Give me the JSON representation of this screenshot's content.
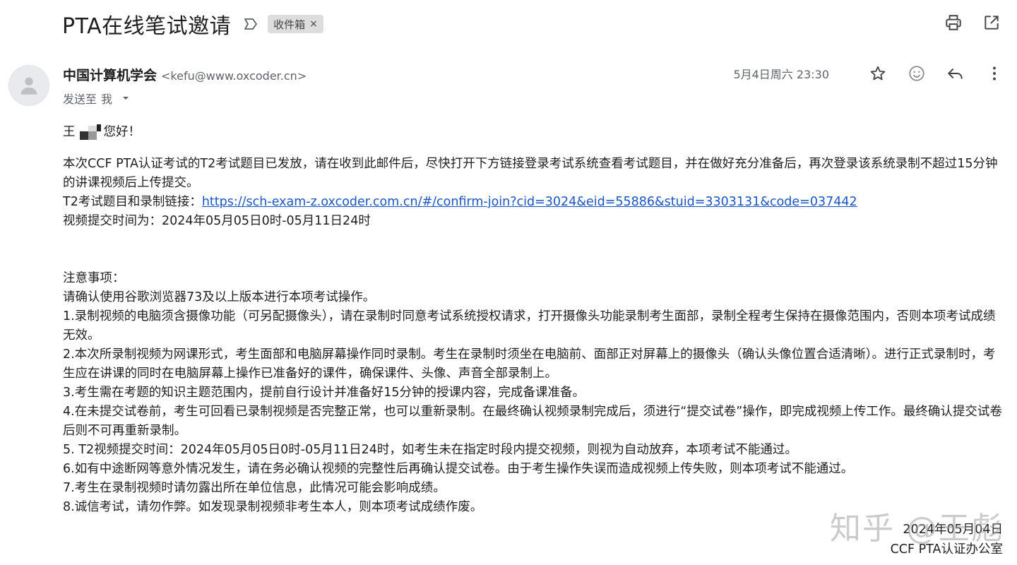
{
  "email": {
    "subject": "PTA在线笔试邀请",
    "label_chip": "收件箱",
    "label_close": "×",
    "sender_name": "中国计算机学会",
    "sender_email": "<kefu@www.oxcoder.cn>",
    "to_prefix": "发送至",
    "to_recipient": "我",
    "date": "5月4日周六 23:30"
  },
  "icons": {
    "important": "label-important-icon",
    "print": "print-icon",
    "open_new_window": "open-in-new-icon",
    "star": "star-icon",
    "emoji": "emoji-icon",
    "reply": "reply-icon",
    "more": "more-vert-icon",
    "expand": "caret-down-icon",
    "avatar": "person-icon"
  },
  "body": {
    "greeting_prefix": "王",
    "greeting_suffix": "您好！",
    "para1": "本次CCF PTA认证考试的T2考试题目已发放，请在收到此邮件后，尽快打开下方链接登录考试系统查看考试题目，并在做好充分准备后，再次登录该系统录制不超过15分钟的讲课视频后上传提交。",
    "link_label": "T2考试题目和录制链接：",
    "link_url": "https://sch-exam-z.oxcoder.com.cn/#/confirm-join?cid=3024&eid=55886&stuid=3303131&code=037442",
    "submit_time": "视频提交时间为：2024年05月05日0时-05月11日24时",
    "notice_title": "注意事项：",
    "notice_intro": "请确认使用谷歌浏览器73及以上版本进行本项考试操作。",
    "notes": [
      "1.录制视频的电脑须含摄像功能（可另配摄像头），请在录制时同意考试系统授权请求，打开摄像头功能录制考生面部，录制全程考生保持在摄像范围内，否则本项考试成绩无效。",
      "2.本次所录制视频为网课形式，考生面部和电脑屏幕操作同时录制。考生在录制时须坐在电脑前、面部正对屏幕上的摄像头（确认头像位置合适清晰）。进行正式录制时，考生应在讲课的同时在电脑屏幕上操作已准备好的课件，确保课件、头像、声音全部录制上。",
      "3.考生需在考题的知识主题范围内，提前自行设计并准备好15分钟的授课内容，完成备课准备。",
      "4.在未提交试卷前，考生可回看已录制视频是否完整正常，也可以重新录制。在最终确认视频录制完成后，须进行“提交试卷”操作，即完成视频上传工作。最终确认提交试卷后则不可再重新录制。",
      "5. T2视频提交时间：2024年05月05日0时-05月11日24时，如考生未在指定时段内提交视频，则视为自动放弃，本项考试不能通过。",
      "6.如有中途断网等意外情况发生，请在务必确认视频的完整性后再确认提交试卷。由于考生操作失误而造成视频上传失败，则本项考试不能通过。",
      "7.考生在录制视频时请勿露出所在单位信息，此情况可能会影响成绩。",
      "8.诚信考试，请勿作弊。如发现录制视频非考生本人，则本项考试成绩作废。"
    ],
    "signature_date": "2024年05月04日",
    "signature_org": "CCF PTA认证办公室"
  },
  "watermark": "知乎 @王彪",
  "colors": {
    "link": "#1a55c6",
    "chip_bg": "#dddddd",
    "muted_text": "#5f6368"
  }
}
